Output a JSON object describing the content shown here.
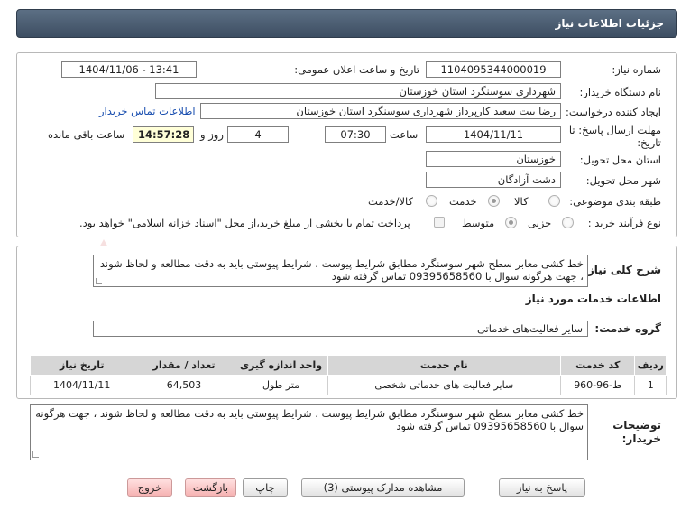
{
  "header": {
    "title": "جزئیات اطلاعات نیاز"
  },
  "fields": {
    "need_number_label": "شماره نیاز:",
    "need_number": "1104095344000019",
    "announce_label": "تاریخ و ساعت اعلان عمومی:",
    "announce_value": "1404/11/06 - 13:41",
    "buyer_label": "نام دستگاه خریدار:",
    "buyer_value": "شهرداری سوسنگرد استان خوزستان",
    "creator_label": "ایجاد کننده درخواست:",
    "creator_value": "رضا بیت سعید کارپرداز شهرداری سوسنگرد استان خوزستان",
    "contact_link": "اطلاعات تماس خریدار",
    "deadline_label_1": "مهلت ارسال پاسخ: تا",
    "deadline_label_2": "تاریخ:",
    "deadline_date": "1404/11/11",
    "time_label": "ساعت",
    "deadline_time": "07:30",
    "days_value": "4",
    "days_label": "روز و",
    "remaining_time": "14:57:28",
    "remaining_label": "ساعت باقی مانده",
    "province_label": "استان محل تحویل:",
    "province_value": "خوزستان",
    "city_label": "شهر محل تحویل:",
    "city_value": "دشت آزادگان",
    "category_label": "طبقه بندی موضوعی:",
    "category_options": [
      "کالا",
      "خدمت",
      "کالا/خدمت"
    ],
    "process_label": "نوع فرآیند خرید :",
    "process_options": [
      "جزیی",
      "متوسط"
    ],
    "payment_note": "پرداخت تمام یا بخشی از مبلغ خرید،از محل \"اسناد خزانه اسلامی\" خواهد بود."
  },
  "description": {
    "label": "شرح کلی نیاز:",
    "text": "خط کشی معابر سطح شهر سوسنگرد مطابق شرایط پیوست ، شرایط پیوستی باید به دقت مطالعه و لحاظ شوند ، جهت هرگونه سوال با 09395658560 تماس گرفته شود"
  },
  "services": {
    "section_title": "اطلاعات خدمات مورد نیاز",
    "group_label": "گروه خدمت:",
    "group_value": "سایر فعالیت‌های خدماتی",
    "columns": [
      "ردیف",
      "کد خدمت",
      "نام خدمت",
      "واحد اندازه گیری",
      "تعداد / مقدار",
      "تاریخ نیاز"
    ],
    "rows": [
      [
        "1",
        "ط-96-960",
        "سایر فعالیت های خدماتی شخصی",
        "متر طول",
        "64,503",
        "1404/11/11"
      ]
    ]
  },
  "buyer_notes": {
    "label_1": "توضیحات",
    "label_2": "خریدار:",
    "text": "خط کشی معابر سطح شهر سوسنگرد مطابق شرایط پیوست ، شرایط پیوستی باید به دقت مطالعه و لحاظ شوند ، جهت هرگونه سوال با 09395658560 تماس گرفته شود"
  },
  "buttons": {
    "reply": "پاسخ به نیاز",
    "attachments": "مشاهده مدارک پیوستی (3)",
    "print": "چاپ",
    "back": "بازگشت",
    "exit": "خروج"
  },
  "watermark": {
    "text": "AriaTender.net"
  },
  "colors": {
    "header": "#4a5b70",
    "link": "#1a4fb0",
    "watermark": "#f2c4c4"
  }
}
